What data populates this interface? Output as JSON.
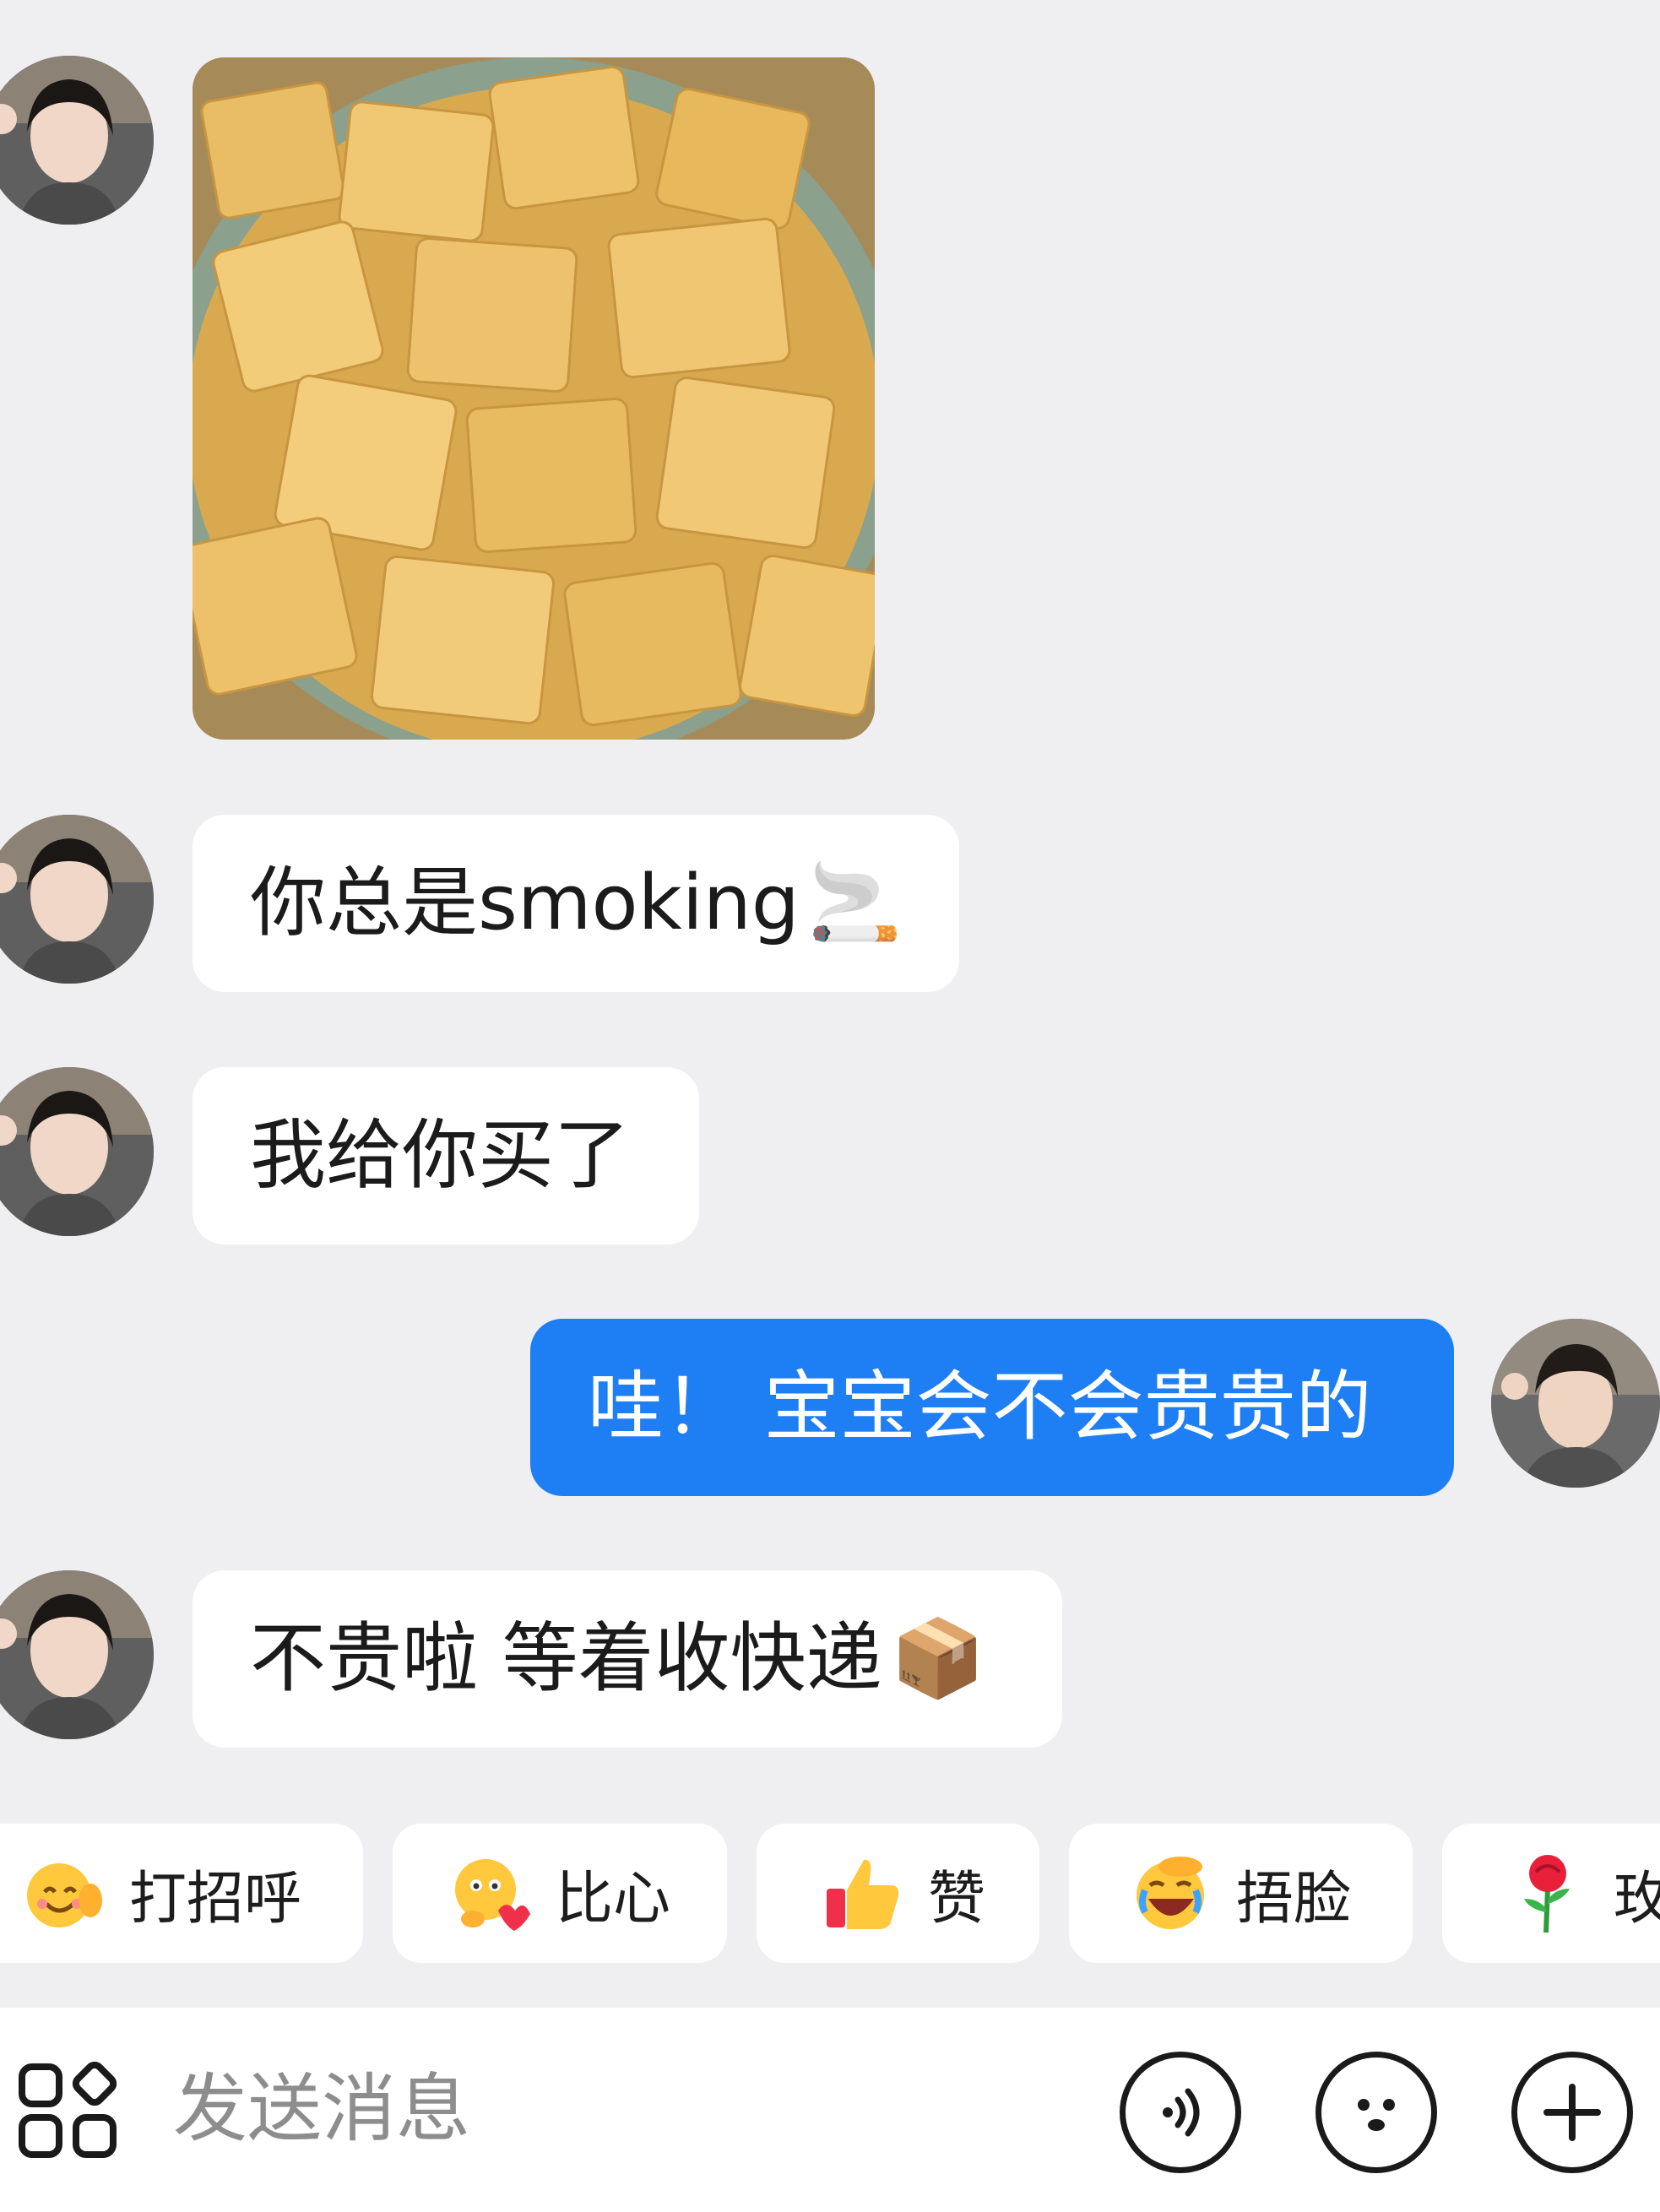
{
  "messages": [
    {
      "from": "friend",
      "type": "image",
      "image_desc": "gold-sugar-cubes-in-bowl"
    },
    {
      "from": "friend",
      "type": "text",
      "text": "你总是smoking",
      "emoji": "🚬"
    },
    {
      "from": "friend",
      "type": "text",
      "text": "我给你买了"
    },
    {
      "from": "me",
      "type": "text",
      "text": "哇！ 宝宝会不会贵贵的"
    },
    {
      "from": "friend",
      "type": "text",
      "text": "不贵啦 等着收快递",
      "emoji": "📦"
    }
  ],
  "quick_replies": [
    {
      "label": "打招呼",
      "icon": "waving-smile-icon"
    },
    {
      "label": "比心",
      "icon": "heart-hands-icon"
    },
    {
      "label": "赞",
      "icon": "thumbs-up-icon"
    },
    {
      "label": "捂脸",
      "icon": "facepalm-icon"
    },
    {
      "label": "玫",
      "icon": "rose-icon"
    }
  ],
  "input": {
    "placeholder": "发送消息"
  },
  "toolbar_icons": [
    "apps-grid-icon",
    "voice-icon",
    "emoji-face-icon",
    "plus-icon"
  ],
  "colors": {
    "background": "#efeff1",
    "my_bubble": "#1e7ef4",
    "bubble": "#ffffff"
  }
}
